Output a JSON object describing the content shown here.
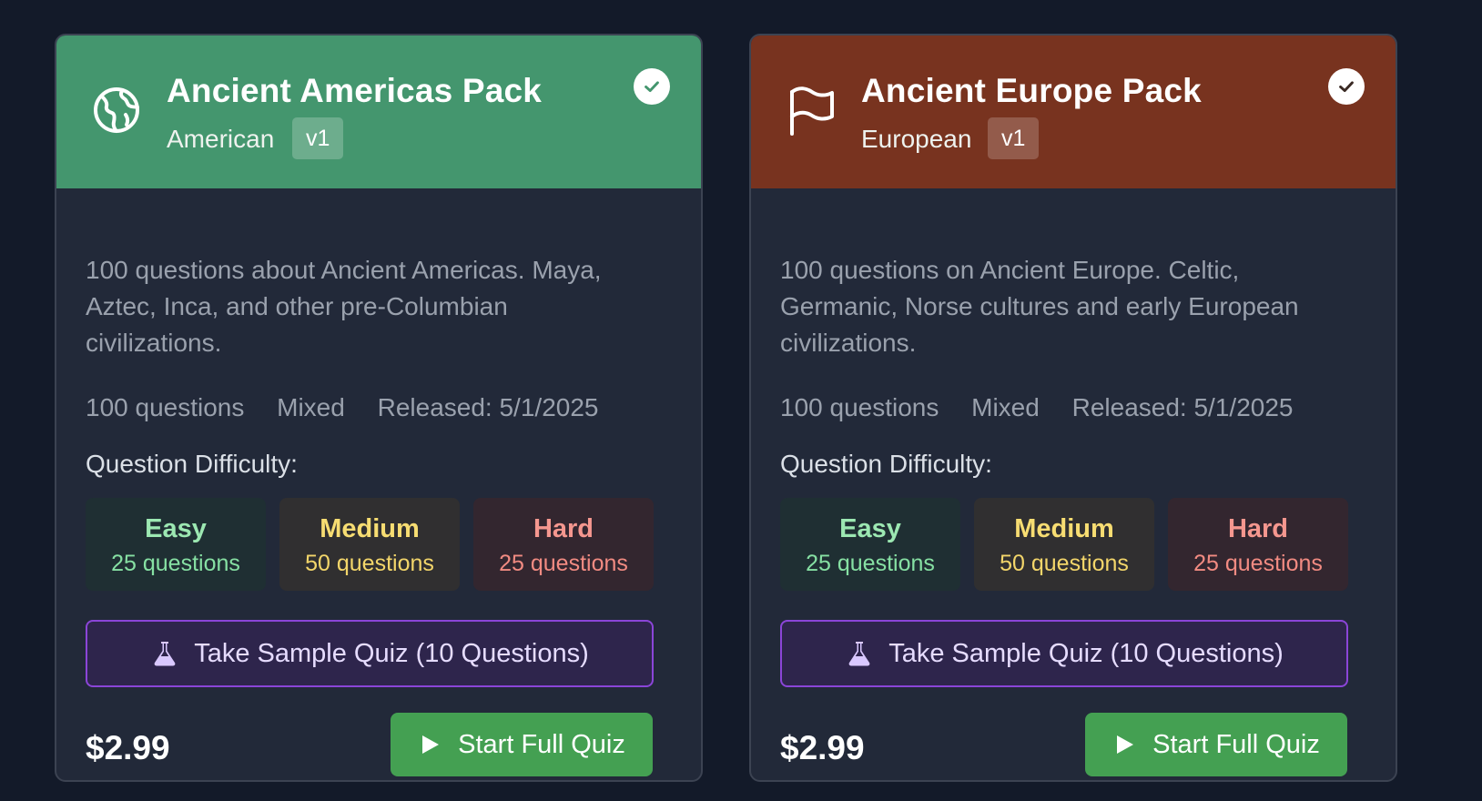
{
  "packs": [
    {
      "title": "Ancient Americas Pack",
      "region": "American",
      "version": "v1",
      "icon": "globe-icon",
      "selected": true,
      "header_color": "#44966e",
      "description": "100 questions about Ancient Americas. Maya, Aztec, Inca, and other pre-Columbian civilizations.",
      "meta": {
        "questions": "100 questions",
        "mix": "Mixed",
        "released": "Released: 5/1/2025"
      },
      "difficulty_label": "Question Difficulty:",
      "difficulty": [
        {
          "name": "Easy",
          "count": "25 questions"
        },
        {
          "name": "Medium",
          "count": "50 questions"
        },
        {
          "name": "Hard",
          "count": "25 questions"
        }
      ],
      "sample_label": "Take Sample Quiz (10 Questions)",
      "price": "$2.99",
      "start_label": "Start Full Quiz"
    },
    {
      "title": "Ancient Europe Pack",
      "region": "European",
      "version": "v1",
      "icon": "flag-icon",
      "selected": true,
      "header_color": "#78331f",
      "description": "100 questions on Ancient Europe. Celtic, Germanic, Norse cultures and early European civilizations.",
      "meta": {
        "questions": "100 questions",
        "mix": "Mixed",
        "released": "Released: 5/1/2025"
      },
      "difficulty_label": "Question Difficulty:",
      "difficulty": [
        {
          "name": "Easy",
          "count": "25 questions"
        },
        {
          "name": "Medium",
          "count": "50 questions"
        },
        {
          "name": "Hard",
          "count": "25 questions"
        }
      ],
      "sample_label": "Take Sample Quiz (10 Questions)",
      "price": "$2.99",
      "start_label": "Start Full Quiz"
    }
  ],
  "colors": {
    "background": "#131a29",
    "card": "#222939",
    "accent_purple": "#8b45d8",
    "start_green": "#44a052",
    "easy": "#86e0a3",
    "medium": "#f3d66a",
    "hard": "#f28b82"
  }
}
